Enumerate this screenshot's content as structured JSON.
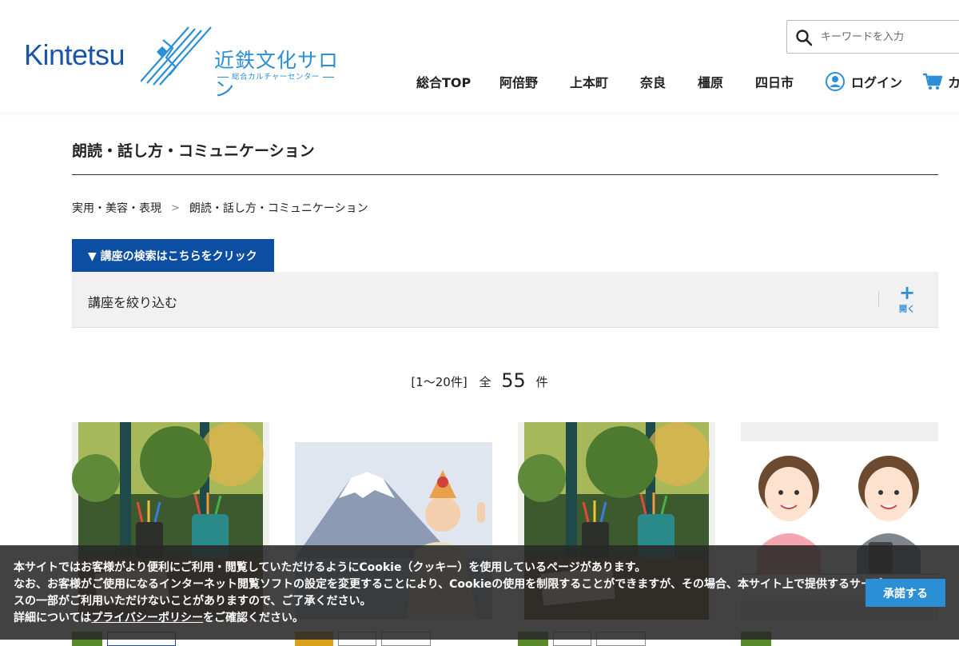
{
  "header": {
    "logo": {
      "brand": "Kintetsu",
      "title": "近鉄文化サロン",
      "subtitle": "総合カルチャーセンター"
    },
    "search": {
      "placeholder": "キーワードを入力"
    },
    "nav": [
      "総合TOP",
      "阿倍野",
      "上本町",
      "奈良",
      "橿原",
      "四日市"
    ],
    "login_label": "ログイン",
    "cart_label": "カ"
  },
  "main": {
    "page_title": "朗読・話し方・コミュニケーション",
    "breadcrumb": [
      "実用・美容・表現",
      "朗読・話し方・コミュニケーション"
    ],
    "breadcrumb_sep": ">",
    "search_toggle_label": "▼ 講座の検索はこちらをクリック",
    "filter": {
      "label": "講座を絞り込む",
      "open_icon": "+",
      "open_label": "開く"
    },
    "count": {
      "range": "[1〜20件]",
      "prefix": "全",
      "total": "55",
      "suffix": "件"
    },
    "cards": [
      {
        "image": "desk-pencils-plants",
        "tags": [
          "",
          ""
        ]
      },
      {
        "image": "fuji-performer",
        "tags": [
          "",
          "",
          ""
        ]
      },
      {
        "image": "desk-pencils-plants",
        "tags": [
          "",
          "",
          ""
        ]
      },
      {
        "image": "two-women-talking",
        "tags": [
          ""
        ]
      }
    ]
  },
  "cookie": {
    "line1": "本サイトではお客様がより便利にご利用・閲覧していただけるようにCookie（クッキー）を使用しているページがあります。",
    "line2": "なお、お客様がご使用になるインターネット閲覧ソフトの設定を変更することにより、Cookieの使用を制限することができますが、その場合、本サイト上で提供するサービスの一部がご利用いただけないことがありますので、ご了承ください。",
    "line3_prefix": "詳細については",
    "line3_link": "プライバシーポリシー",
    "line3_suffix": "をご確認ください。",
    "accept_label": "承諾する"
  },
  "colors": {
    "brand_blue": "#1a56a8",
    "accent_blue": "#2b8fd6",
    "toggle_bg": "#0b4ea2",
    "filter_bg": "#f1f1f1",
    "cookie_bg": "#282828"
  }
}
